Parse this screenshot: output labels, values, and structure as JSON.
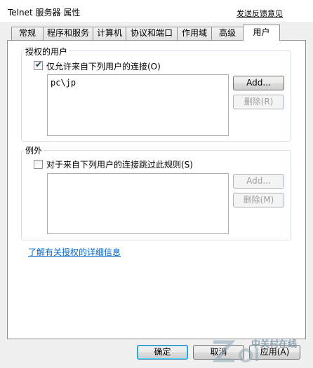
{
  "window": {
    "title": "Telnet 服务器 属性",
    "feedback_link": "发送反馈意见"
  },
  "tabs": [
    {
      "label": "常规",
      "active": false
    },
    {
      "label": "程序和服务",
      "active": false
    },
    {
      "label": "计算机",
      "active": false
    },
    {
      "label": "协议和端口",
      "active": false
    },
    {
      "label": "作用域",
      "active": false
    },
    {
      "label": "高级",
      "active": false
    },
    {
      "label": "用户",
      "active": true
    }
  ],
  "authorized_users": {
    "group_label": "授权的用户",
    "checkbox_label": "仅允许来自下列用户的连接(O)",
    "checked": true,
    "users": [
      "pc\\jp"
    ],
    "add_button": "Add...",
    "remove_button": "删除(R)"
  },
  "exceptions": {
    "group_label": "例外",
    "checkbox_label": "对于来自下列用户的连接跳过此规则(S)",
    "checked": false,
    "users": [],
    "add_button": "Add...",
    "remove_button": "删除(M)"
  },
  "help_link": "了解有关授权的详细信息",
  "footer": {
    "ok_button": "确定",
    "cancel_button": "取消",
    "apply_button": "应用(A)"
  },
  "watermark": {
    "brand": "中关村在线"
  }
}
